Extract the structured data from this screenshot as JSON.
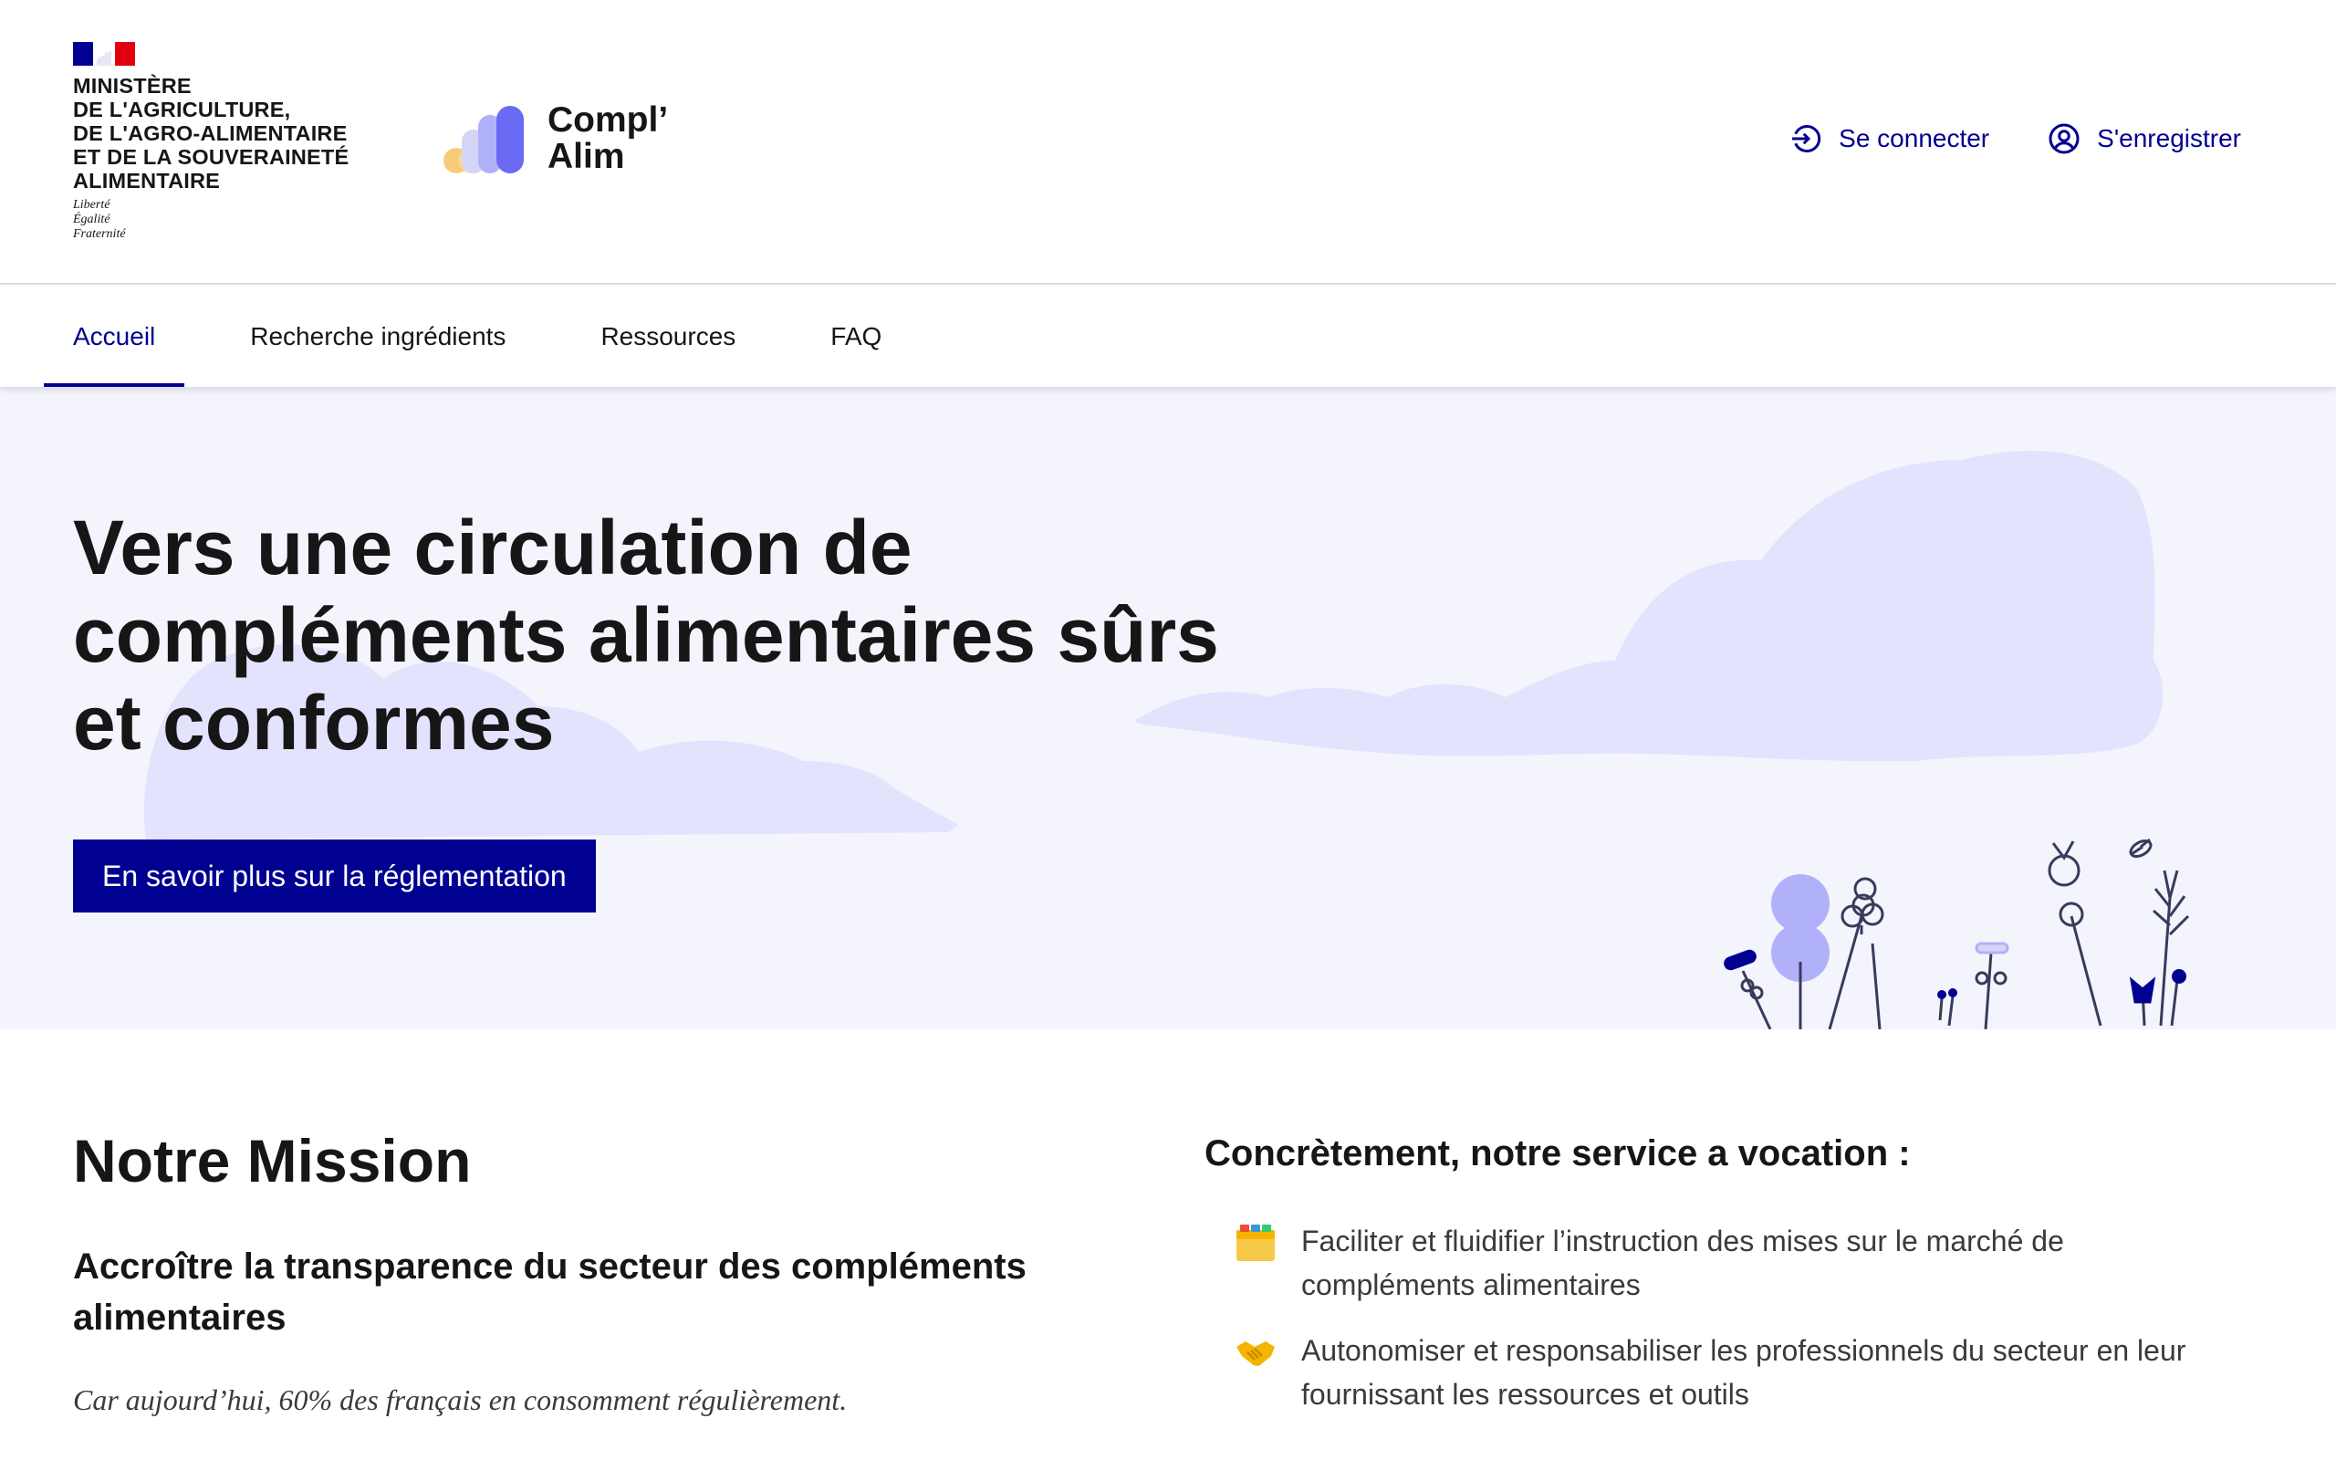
{
  "header": {
    "ministry_lines": [
      "MINISTÈRE",
      "DE L'AGRICULTURE,",
      "DE L'AGRO-ALIMENTAIRE",
      "ET DE LA SOUVERAINETÉ",
      "ALIMENTAIRE"
    ],
    "devise": [
      "Liberté",
      "Égalité",
      "Fraternité"
    ],
    "brand_line1": "Compl’",
    "brand_line2": "Alim",
    "login_label": "Se connecter",
    "login_icon": "login-icon",
    "register_label": "S'enregistrer",
    "register_icon": "account-circle-icon"
  },
  "nav": {
    "items": [
      {
        "label": "Accueil",
        "active": true
      },
      {
        "label": "Recherche ingrédients",
        "active": false
      },
      {
        "label": "Ressources",
        "active": false
      },
      {
        "label": "FAQ",
        "active": false
      }
    ]
  },
  "hero": {
    "title_lines": [
      "Vers une circulation de",
      "compléments alimentaires sûrs",
      "et conformes"
    ],
    "cta_label": "En savoir plus sur la réglementation"
  },
  "mission": {
    "title": "Notre Mission",
    "subtitle_lines": [
      "Accroître la transparence du secteur des compléments",
      "alimentaires"
    ],
    "quote": "Car aujourd’hui, 60% des français en consomment régulièrement."
  },
  "service": {
    "title": "Concrètement, notre service a vocation :",
    "items": [
      {
        "emoji": "🗂️",
        "icon": "card-index-dividers-icon",
        "lines": [
          "Faciliter et fluidifier l’instruction des mises sur le marché de",
          "compléments alimentaires"
        ]
      },
      {
        "emoji": "🤝",
        "icon": "handshake-icon",
        "lines": [
          "Autonomiser et responsabiliser les professionnels du secteur en leur",
          "fournissant les ressources et outils"
        ]
      }
    ]
  },
  "colors": {
    "primary": "#000091",
    "hero_bg": "#f4f4fd",
    "cloud": "#e3e3fd",
    "text": "#161616"
  }
}
